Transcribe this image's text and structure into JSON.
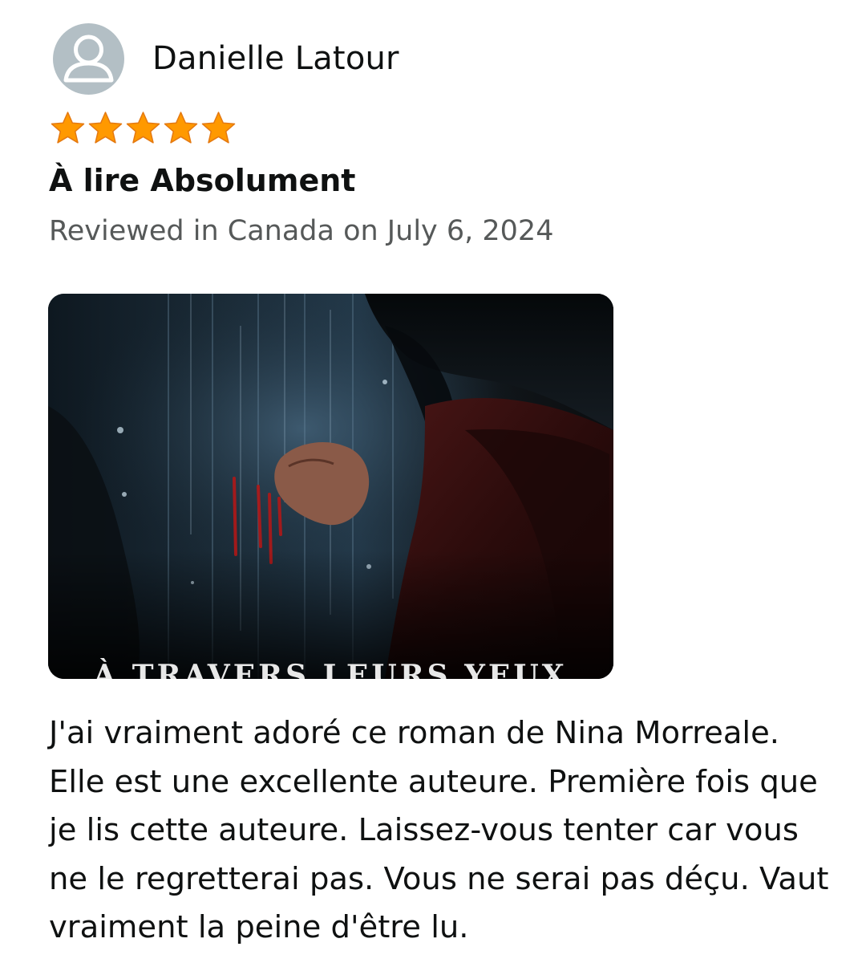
{
  "review": {
    "reviewer_name": "Danielle Latour",
    "avatar_icon": "person-icon",
    "rating": 5,
    "rating_max": 5,
    "star_color": "#ff9900",
    "title": "À lire Absolument",
    "meta": "Reviewed in Canada on July 6, 2024",
    "image": {
      "caption_text": "À TRAVERS LEURS YEUX"
    },
    "body": "J'ai vraiment adoré ce roman de Nina Morreale. Elle est une excellente auteure. Première fois que je lis cette auteure. Laissez-vous tenter car vous ne le regretterai pas. Vous ne serai pas déçu. Vaut vraiment la peine d'être lu."
  }
}
